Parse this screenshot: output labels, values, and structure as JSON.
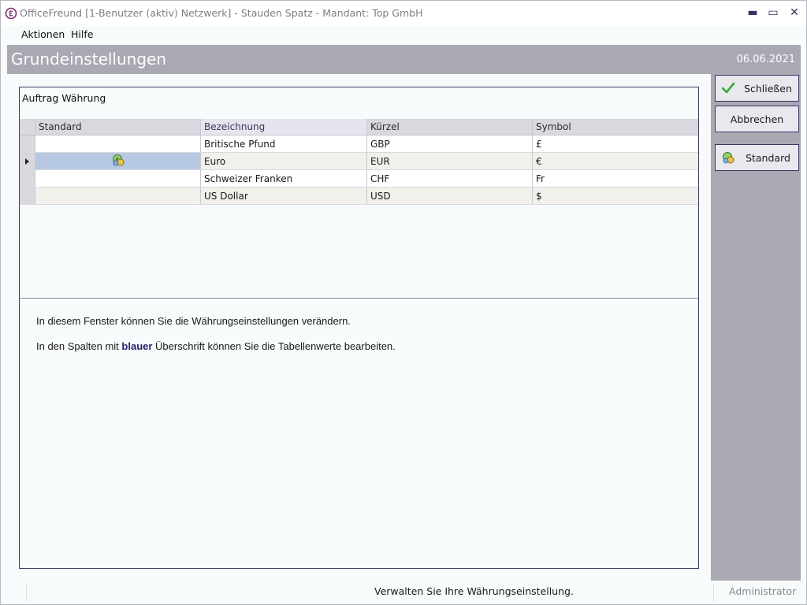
{
  "window": {
    "title": "OfficeFreund [1-Benutzer (aktiv) Netzwerk]  -  Stauden Spatz  -  Mandant: Top GmbH",
    "controls": {
      "minimize": "▬",
      "maximize": "▭",
      "close": "✕"
    }
  },
  "menu": {
    "items": [
      {
        "label": "Aktionen"
      },
      {
        "label": "Hilfe"
      }
    ]
  },
  "header": {
    "title": "Grundeinstellungen",
    "date": "06.06.2021",
    "color": "#a9a8b3"
  },
  "sidebar": {
    "close_label": "Schließen",
    "cancel_label": "Abbrechen",
    "default_label": "Standard"
  },
  "section": {
    "title": "Auftrag Währung"
  },
  "grid": {
    "columns": [
      "Standard",
      "Bezeichnung",
      "Kürzel",
      "Symbol"
    ],
    "rows": [
      {
        "standard": "",
        "bezeichnung": "Britische Pfund",
        "kuerzel": "GBP",
        "symbol": "£"
      },
      {
        "standard": "coin-icon",
        "bezeichnung": "Euro",
        "kuerzel": "EUR",
        "symbol": "€"
      },
      {
        "standard": "",
        "bezeichnung": "Schweizer Franken",
        "kuerzel": "CHF",
        "symbol": "Fr"
      },
      {
        "standard": "",
        "bezeichnung": "US Dollar",
        "kuerzel": "USD",
        "symbol": "$"
      }
    ],
    "selected_row": 1
  },
  "info": {
    "line1": "In diesem Fenster können Sie die Währungseinstellungen verändern.",
    "line2_pre": "In den Spalten mit ",
    "line2_em": "blauer",
    "line2_post": " Überschrift können Sie die Tabellenwerte bearbeiten."
  },
  "status": {
    "message": "Verwalten Sie Ihre Währungseinstellung.",
    "user": "Administrator"
  }
}
